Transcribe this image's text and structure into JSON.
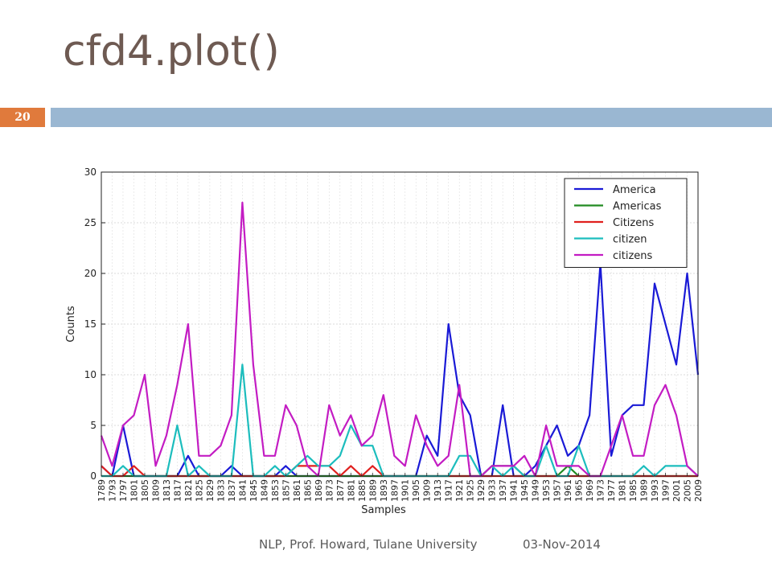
{
  "slide": {
    "title": "cfd4.plot()",
    "page_number": "20",
    "footer_left": "NLP, Prof. Howard, Tulane University",
    "footer_right": "03-Nov-2014",
    "accent_bar_color": "#9ab7d2",
    "badge_color": "#e07a3c"
  },
  "chart_data": {
    "type": "line",
    "xlabel": "Samples",
    "ylabel": "Counts",
    "ylim": [
      0,
      30
    ],
    "yticks": [
      0,
      5,
      10,
      15,
      20,
      25,
      30
    ],
    "grid": true,
    "legend_position": "top-right",
    "categories": [
      "1789",
      "1793",
      "1797",
      "1801",
      "1805",
      "1809",
      "1813",
      "1817",
      "1821",
      "1825",
      "1829",
      "1833",
      "1837",
      "1841",
      "1845",
      "1849",
      "1853",
      "1857",
      "1861",
      "1865",
      "1869",
      "1873",
      "1877",
      "1881",
      "1885",
      "1889",
      "1893",
      "1897",
      "1901",
      "1905",
      "1909",
      "1913",
      "1917",
      "1921",
      "1925",
      "1929",
      "1933",
      "1937",
      "1941",
      "1945",
      "1949",
      "1953",
      "1957",
      "1961",
      "1965",
      "1969",
      "1973",
      "1977",
      "1981",
      "1985",
      "1989",
      "1993",
      "1997",
      "2001",
      "2005",
      "2009"
    ],
    "series": [
      {
        "name": "America",
        "color": "#1a1ad6",
        "values": [
          1,
          0,
          5,
          0,
          0,
          0,
          0,
          0,
          2,
          0,
          0,
          0,
          1,
          0,
          0,
          0,
          0,
          1,
          0,
          0,
          0,
          0,
          0,
          0,
          0,
          0,
          0,
          0,
          0,
          0,
          4,
          2,
          15,
          8,
          6,
          0,
          0,
          7,
          0,
          0,
          1,
          3,
          5,
          2,
          3,
          6,
          21,
          2,
          6,
          7,
          7,
          19,
          15,
          11,
          20,
          10
        ]
      },
      {
        "name": "Americas",
        "color": "#228b22",
        "values": [
          0,
          0,
          0,
          0,
          0,
          0,
          0,
          0,
          0,
          0,
          0,
          0,
          0,
          0,
          0,
          0,
          0,
          0,
          0,
          0,
          0,
          0,
          0,
          0,
          0,
          0,
          0,
          0,
          0,
          0,
          0,
          0,
          0,
          0,
          0,
          0,
          1,
          1,
          1,
          0,
          0,
          0,
          0,
          1,
          0,
          0,
          0,
          0,
          0,
          0,
          0,
          0,
          0,
          0,
          0,
          0
        ]
      },
      {
        "name": "Citizens",
        "color": "#e0201e",
        "values": [
          1,
          0,
          0,
          1,
          0,
          0,
          0,
          0,
          0,
          0,
          0,
          0,
          0,
          0,
          0,
          0,
          0,
          0,
          1,
          1,
          1,
          1,
          0,
          1,
          0,
          1,
          0,
          0,
          0,
          0,
          0,
          0,
          0,
          0,
          0,
          0,
          0,
          0,
          0,
          0,
          0,
          0,
          0,
          0,
          0,
          0,
          0,
          0,
          0,
          0,
          0,
          0,
          0,
          0,
          0,
          0
        ]
      },
      {
        "name": "citizen",
        "color": "#1cbdbd",
        "values": [
          0,
          0,
          1,
          0,
          0,
          0,
          0,
          5,
          0,
          1,
          0,
          0,
          0,
          11,
          0,
          0,
          1,
          0,
          1,
          2,
          1,
          1,
          2,
          5,
          3,
          3,
          0,
          0,
          0,
          0,
          0,
          0,
          0,
          2,
          2,
          0,
          1,
          0,
          1,
          0,
          0,
          3,
          0,
          0,
          3,
          0,
          0,
          0,
          0,
          0,
          1,
          0,
          1,
          1,
          1,
          0
        ]
      },
      {
        "name": "citizens",
        "color": "#c31cc3",
        "values": [
          4,
          1,
          5,
          6,
          10,
          1,
          4,
          9,
          15,
          2,
          2,
          3,
          6,
          27,
          11,
          2,
          2,
          7,
          5,
          1,
          0,
          7,
          4,
          6,
          3,
          4,
          8,
          2,
          1,
          6,
          3,
          1,
          2,
          9,
          0,
          0,
          1,
          1,
          1,
          2,
          0,
          5,
          1,
          1,
          1,
          0,
          0,
          3,
          6,
          2,
          2,
          7,
          9,
          6,
          1,
          0
        ]
      }
    ]
  }
}
